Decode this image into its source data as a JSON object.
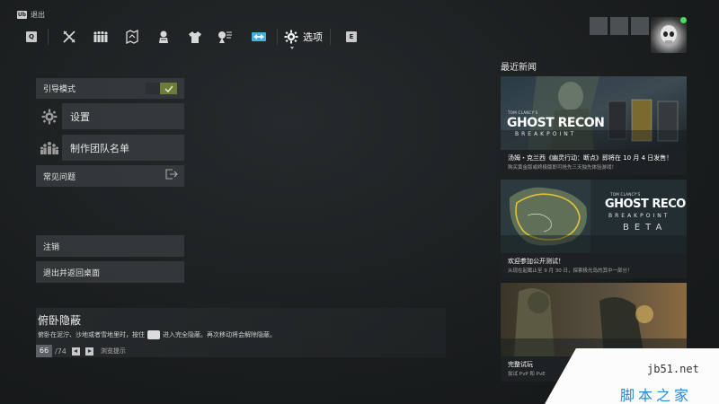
{
  "window": {
    "app_icon_text": "Ub",
    "title": "退出"
  },
  "nav": {
    "left_key": "Q",
    "right_key": "E",
    "active_label": "选项"
  },
  "menu": {
    "guide_mode": "引导模式",
    "settings": "设置",
    "credits": "制作团队名单",
    "faq": "常见问题",
    "logout": "注销",
    "exit_desktop": "退出并返回桌面"
  },
  "hint": {
    "title": "俯卧隐蔽",
    "body_before": "俯卧在泥泞、沙地或者雪地里时，按住",
    "body_after": "进入完全隐蔽。再次移动将会解除隐蔽。",
    "current": "66",
    "total": "/74",
    "browse_label": "浏览提示"
  },
  "news": {
    "heading": "最近新闻",
    "cards": [
      {
        "brand": "TOM CLANCY'S",
        "game_title": "GHOST RECON",
        "game_sub": "BREAKPOINT",
        "caption": "汤姆・克兰西《幽灵行动：断点》即将在 10 月 4 日发售！",
        "sub": "购买黄金版或终极版即可抢先三天独先体验游戏！"
      },
      {
        "brand": "TOM CLANCY'S",
        "game_title": "GHOST RECON",
        "game_sub": "BREAKPOINT",
        "badge": "BETA",
        "caption": "欢迎参加公开测试！",
        "sub": "从现在起截止至 9 月 30 日，探索极光岛的其中一部分！"
      },
      {
        "caption": "完整试玩",
        "sub": "尝试 PvP 和 PvE"
      }
    ]
  },
  "watermark": {
    "url": "jb51.net",
    "text": "脚本之家"
  },
  "colors": {
    "toggle_on": "#6c7d3a",
    "online": "#4cd964",
    "map_route": "#e0c23a"
  }
}
